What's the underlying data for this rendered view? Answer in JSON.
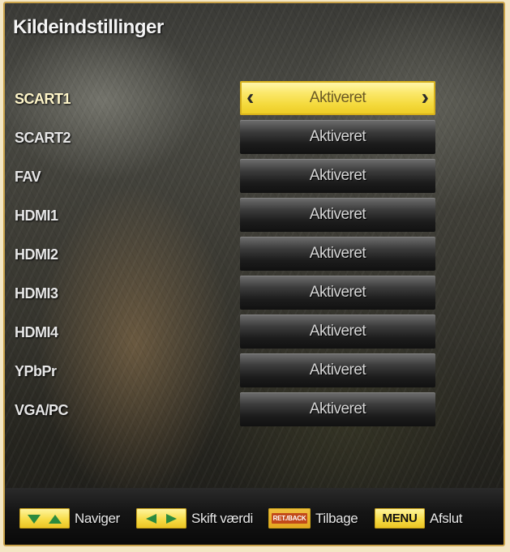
{
  "title": "Kildeindstillinger",
  "rows": [
    {
      "label": "SCART1",
      "value": "Aktiveret",
      "selected": true
    },
    {
      "label": "SCART2",
      "value": "Aktiveret"
    },
    {
      "label": "FAV",
      "value": "Aktiveret"
    },
    {
      "label": "HDMI1",
      "value": "Aktiveret"
    },
    {
      "label": "HDMI2",
      "value": "Aktiveret"
    },
    {
      "label": "HDMI3",
      "value": "Aktiveret"
    },
    {
      "label": "HDMI4",
      "value": "Aktiveret"
    },
    {
      "label": "YPbPr",
      "value": "Aktiveret"
    },
    {
      "label": "VGA/PC",
      "value": "Aktiveret"
    }
  ],
  "selector": {
    "left_arrow": "‹",
    "right_arrow": "›"
  },
  "footer": {
    "navigate": {
      "label": "Naviger",
      "icon": "up-down-arrows-icon"
    },
    "change": {
      "label": "Skift værdi",
      "icon": "left-right-arrows-icon"
    },
    "back": {
      "key": "RET./BACK",
      "label": "Tilbage"
    },
    "exit": {
      "key": "MENU",
      "label": "Afslut"
    }
  },
  "colors": {
    "accent": "#f7dc47",
    "selected_text": "#6b5a25",
    "bar_dark": "#1c1c1c"
  }
}
